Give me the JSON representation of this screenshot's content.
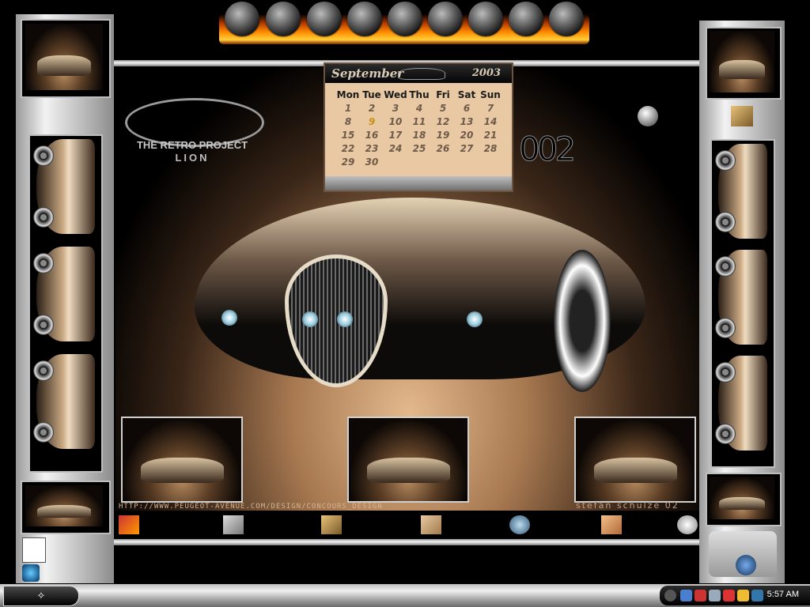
{
  "calendar": {
    "month": "September",
    "year": "2003",
    "weekdays": [
      "Mon",
      "Tue",
      "Wed",
      "Thu",
      "Fri",
      "Sat",
      "Sun"
    ],
    "weeks": [
      [
        "1",
        "2",
        "3",
        "4",
        "5",
        "6",
        "7"
      ],
      [
        "8",
        "9",
        "10",
        "11",
        "12",
        "13",
        "14"
      ],
      [
        "15",
        "16",
        "17",
        "18",
        "19",
        "20",
        "21"
      ],
      [
        "22",
        "23",
        "24",
        "25",
        "26",
        "27",
        "28"
      ],
      [
        "29",
        "30",
        "",
        "",
        "",
        "",
        ""
      ]
    ],
    "today": "9"
  },
  "logo": {
    "line1": "THE RETRO PROJECT",
    "line2": "LION"
  },
  "badge": {
    "number": "002"
  },
  "wallpaper": {
    "url": "HTTP://WWW.PEUGEOT-AVENUE.COM/DESIGN/CONCOURS_DESIGN",
    "author": "stefan schulze 02"
  },
  "taskbar": {
    "clock": "5:57 AM"
  },
  "tray_icons": [
    "chevron-left-icon",
    "network-icon",
    "security-icon",
    "users-icon",
    "antivirus-icon",
    "zonealarm-icon",
    "fx-icon"
  ],
  "strip_icons": [
    "paper-icon",
    "scanner-icon",
    "monitor-icon",
    "folder-icon",
    "globe-icon",
    "box-icon",
    "clock-icon"
  ],
  "colors": {
    "accent": "#d4b38f",
    "today": "#c8901a"
  }
}
